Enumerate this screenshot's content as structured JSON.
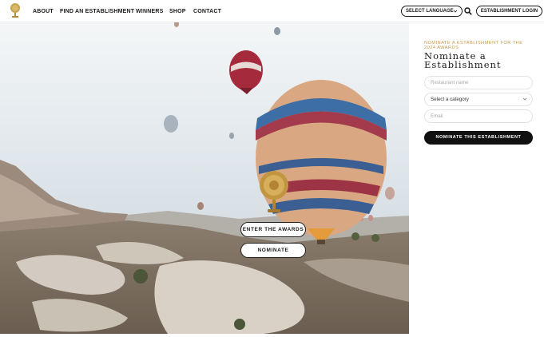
{
  "nav": {
    "items": [
      "ABOUT",
      "FIND AN ESTABLISHMENT",
      "WINNERS",
      "SHOP",
      "CONTACT"
    ],
    "language_label": "SELECT LANGUAGE",
    "login_label": "ESTABLISHMENT LOGIN",
    "icons": [
      "trophy-logo-icon",
      "chevron-down-icon",
      "search-icon"
    ]
  },
  "hero": {
    "enter_label": "ENTER THE AWARDS",
    "nominate_label": "NOMINATE",
    "icons": [
      "trophy-emblem-icon"
    ]
  },
  "form": {
    "kicker": "NOMINATE A ESTABLISHMENT FOR THE 2024 AWARDS",
    "title": "Nominate a Establishment",
    "restaurant_placeholder": "Restaurant name",
    "category_value": "Select a category",
    "email_placeholder": "Email",
    "submit_label": "NOMINATE THIS ESTABLISHMENT"
  },
  "colors": {
    "accent_gold": "#c99a4b",
    "dark": "#111111",
    "sky": "#dce4ea"
  }
}
